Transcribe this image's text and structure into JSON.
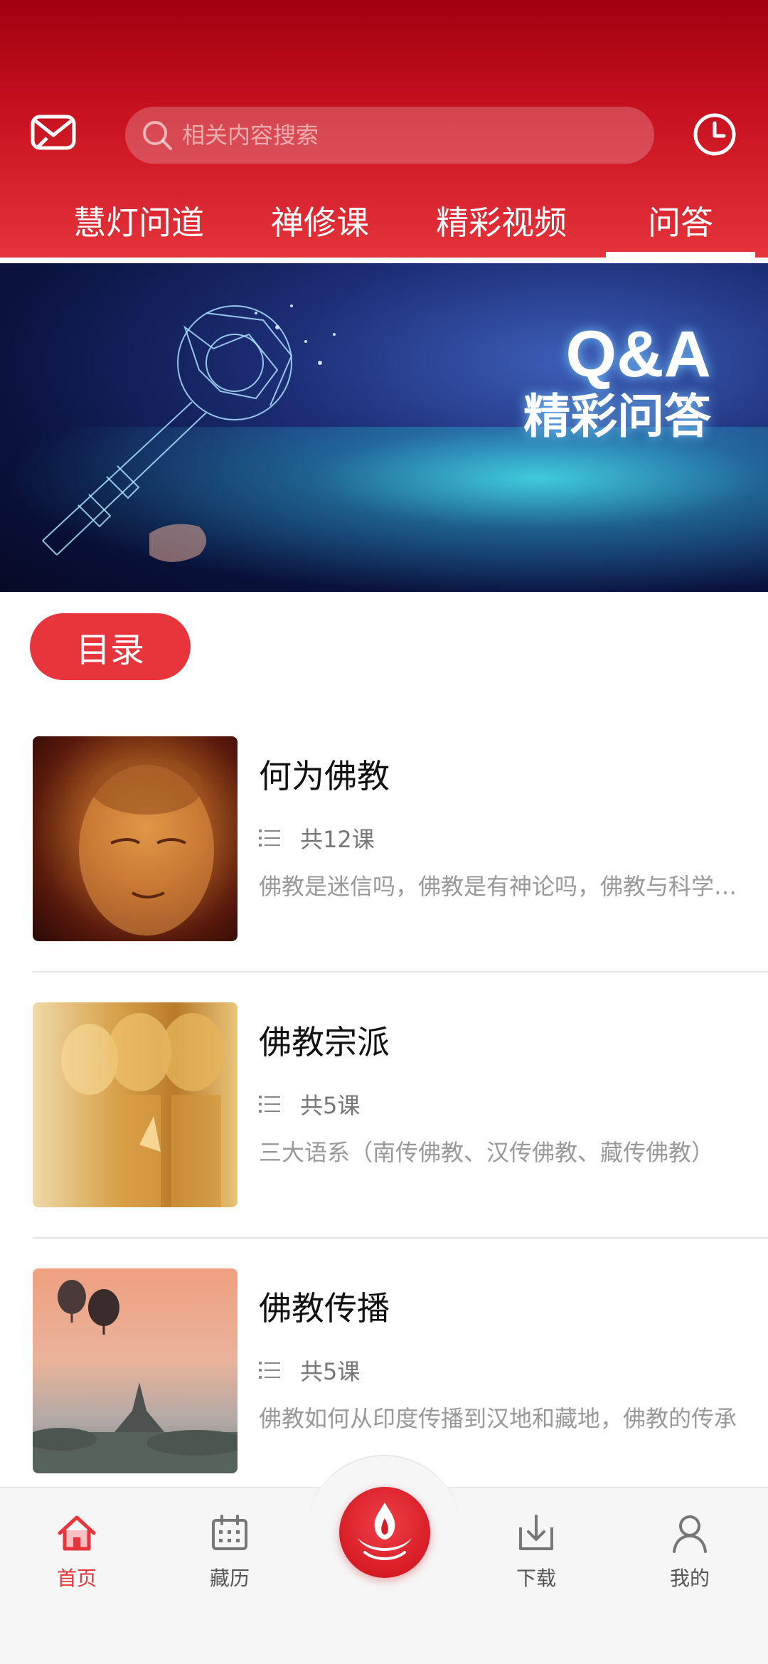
{
  "header": {
    "search_placeholder": "相关内容搜索",
    "mail_icon": "mail-icon",
    "history_icon": "clock-icon",
    "tabs": [
      {
        "label": "慧灯问道",
        "active": false
      },
      {
        "label": "禅修课",
        "active": false
      },
      {
        "label": "精彩视频",
        "active": false
      },
      {
        "label": "问答",
        "active": true
      }
    ]
  },
  "banner": {
    "title": "Q&A",
    "subtitle": "精彩问答"
  },
  "catalog": {
    "label": "目录"
  },
  "courses": [
    {
      "title": "何为佛教",
      "count": "共12课",
      "description": "佛教是迷信吗，佛教是有神论吗，佛教与科学，佛教与宗教"
    },
    {
      "title": "佛教宗派",
      "count": "共5课",
      "description": "三大语系（南传佛教、汉传佛教、藏传佛教）"
    },
    {
      "title": "佛教传播",
      "count": "共5课",
      "description": "佛教如何从印度传播到汉地和藏地，佛教的传承"
    }
  ],
  "bottom_nav": [
    {
      "label": "首页",
      "icon": "home-icon",
      "active": true
    },
    {
      "label": "藏历",
      "icon": "calendar-icon",
      "active": false
    },
    {
      "label": "",
      "icon": "flame-lotus-icon",
      "active": false
    },
    {
      "label": "下载",
      "icon": "download-icon",
      "active": false
    },
    {
      "label": "我的",
      "icon": "user-icon",
      "active": false
    }
  ],
  "colors": {
    "brand_red": "#e8353c",
    "header_dark_red": "#a10010",
    "text_secondary": "#999999"
  }
}
